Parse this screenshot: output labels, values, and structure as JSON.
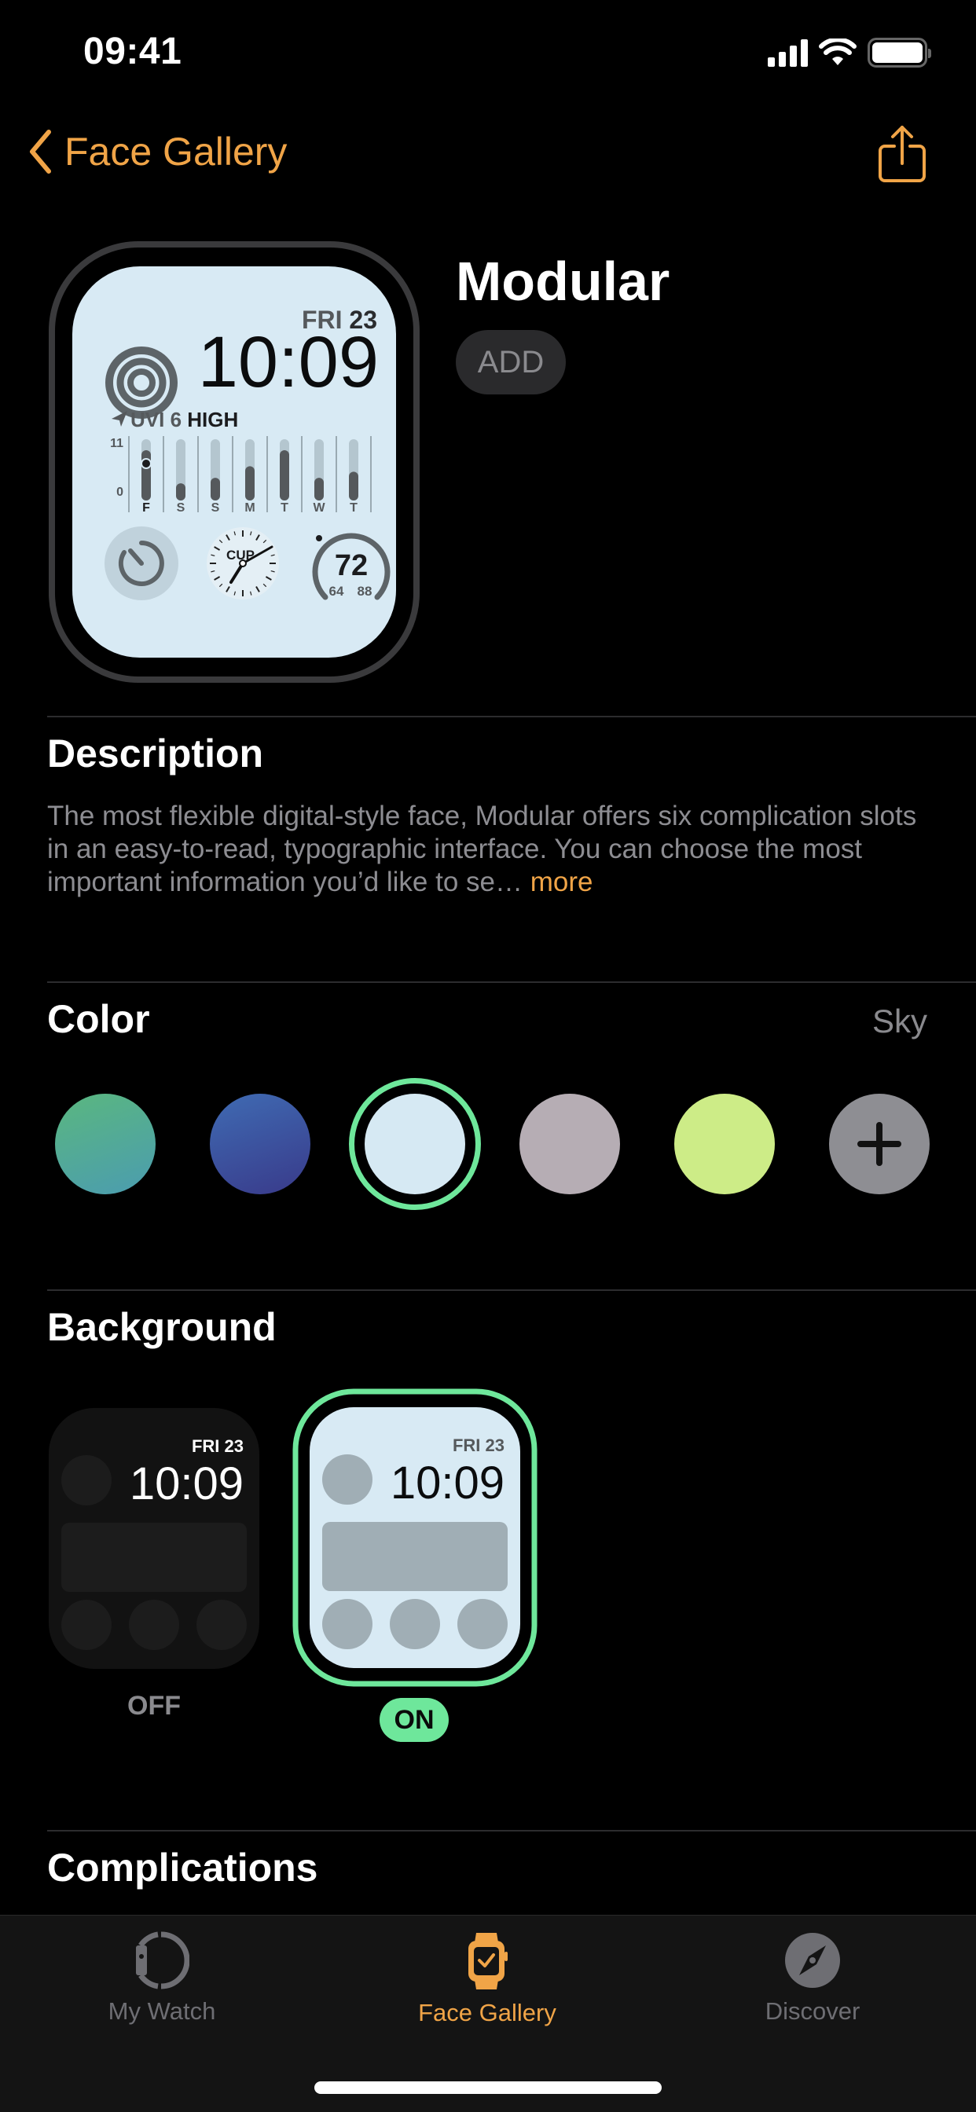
{
  "status_bar": {
    "time": "09:41"
  },
  "nav": {
    "back_label": "Face Gallery",
    "back_icon": "chevron-left-icon",
    "share_icon": "share-icon"
  },
  "face": {
    "title": "Modular",
    "add_label": "ADD",
    "preview": {
      "date_day": "FRI",
      "date_num": "23",
      "time": "10:09",
      "uvi_label": "UVI 6",
      "uvi_level": "HIGH",
      "uvi_scale_max": "11",
      "uvi_scale_min": "0",
      "uvi_days": [
        "F",
        "S",
        "S",
        "M",
        "T",
        "W",
        "T"
      ],
      "uvi_values": [
        0.82,
        0.28,
        0.37,
        0.56,
        0.82,
        0.37,
        0.47
      ],
      "clock_label": "CUP",
      "temp_current": "72",
      "temp_low": "64",
      "temp_high": "88"
    }
  },
  "description": {
    "title": "Description",
    "text": "The most flexible digital-style face, Modular offers six complication slots in an easy-to-read, typographic interface. You can choose the most important information you’d like to se…",
    "more_label": "more"
  },
  "color": {
    "title": "Color",
    "selected_name": "Sky",
    "swatches": [
      {
        "name": "green-teal",
        "from": "#5ab77f",
        "to": "#4b9cb0"
      },
      {
        "name": "blue",
        "from": "#3f6bb3",
        "to": "#393a8a"
      },
      {
        "name": "sky",
        "from": "#d6e9f3",
        "to": "#d6e9f3",
        "selected": true
      },
      {
        "name": "lavender-gray",
        "from": "#b6adb4",
        "to": "#b6adb4"
      },
      {
        "name": "lime",
        "from": "#cdec87",
        "to": "#cdec87"
      }
    ],
    "add_icon": "plus-icon",
    "selection_color": "#6ee79b"
  },
  "background": {
    "title": "Background",
    "options": [
      {
        "label": "OFF",
        "date": "FRI 23",
        "time": "10:09"
      },
      {
        "label": "ON",
        "date": "FRI 23",
        "time": "10:09",
        "selected": true
      }
    ]
  },
  "complications": {
    "title": "Complications"
  },
  "tab_bar": {
    "tabs": [
      {
        "label": "My Watch",
        "icon": "watch-side-icon",
        "active": false
      },
      {
        "label": "Face Gallery",
        "icon": "watch-face-icon",
        "active": true
      },
      {
        "label": "Discover",
        "icon": "compass-icon",
        "active": false
      }
    ],
    "active_color": "#f0a447",
    "inactive_color": "#6e6e73"
  }
}
